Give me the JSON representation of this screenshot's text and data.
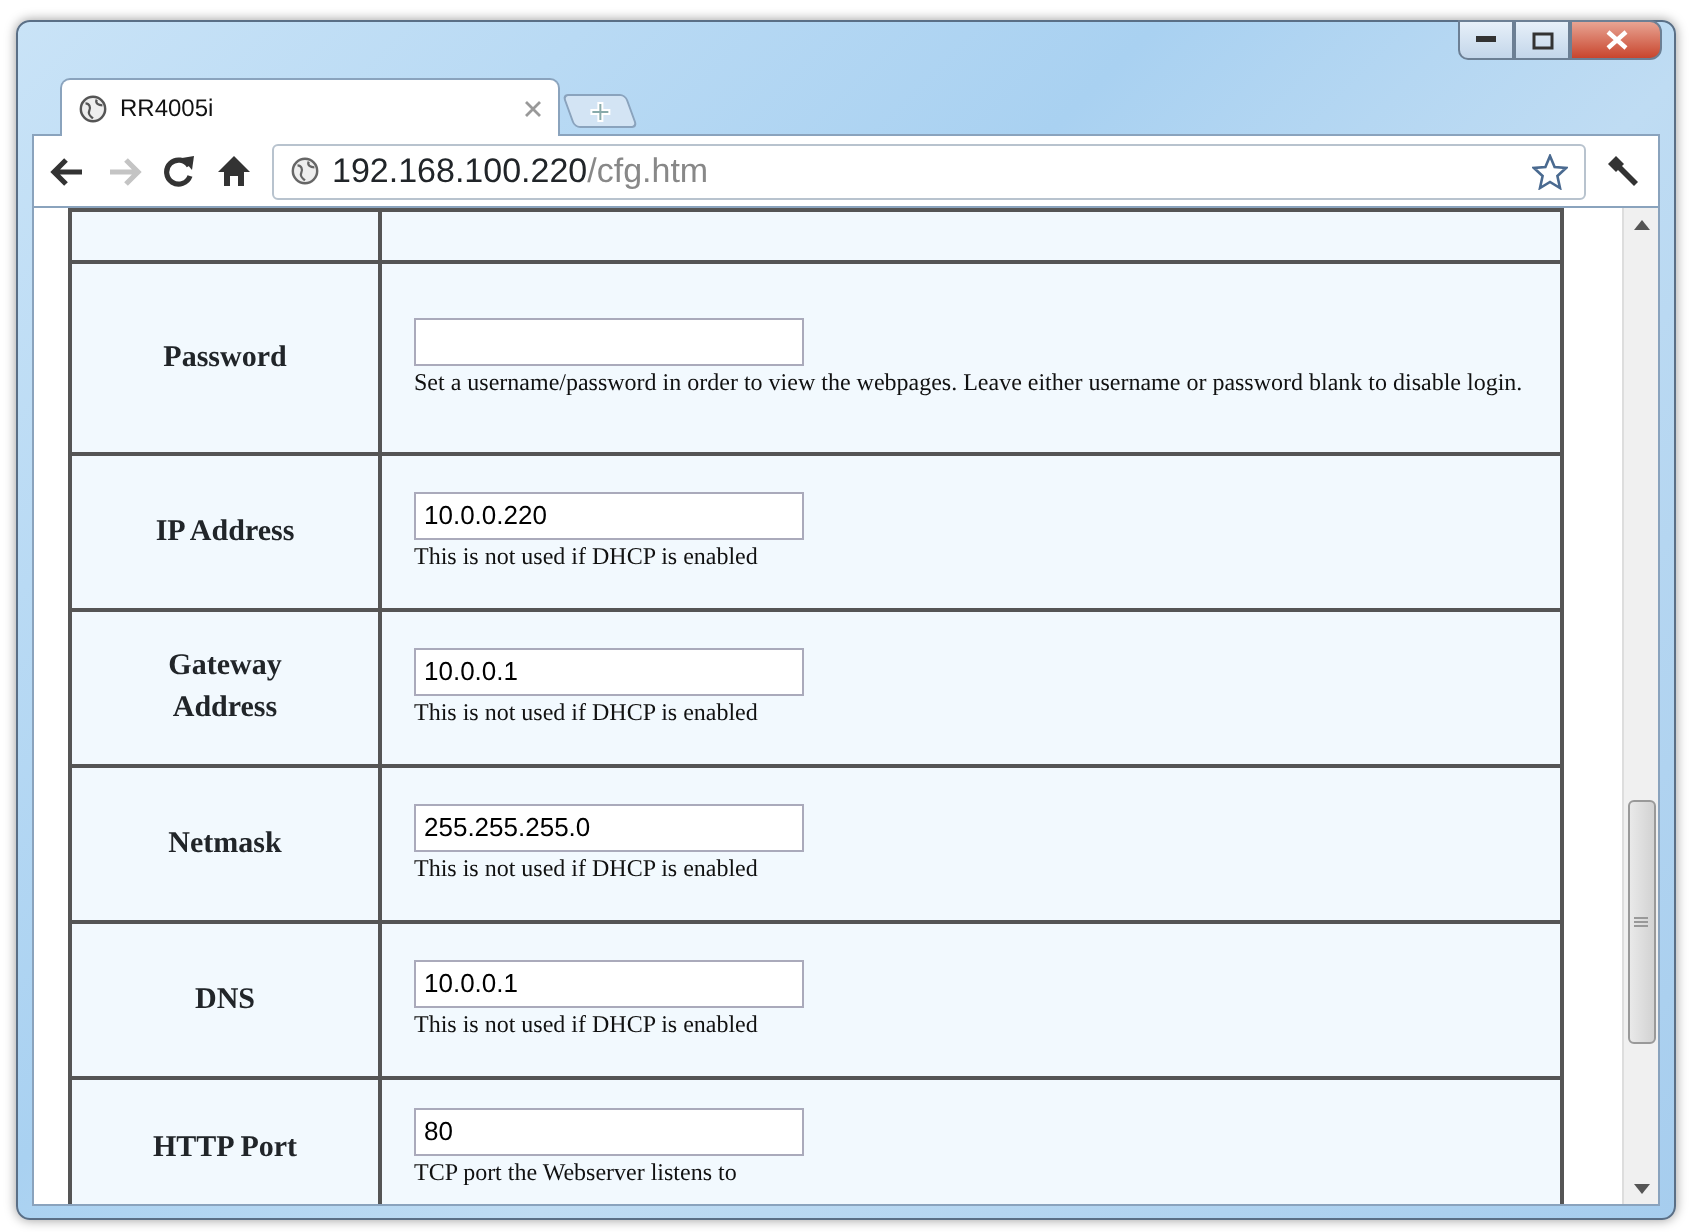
{
  "tab": {
    "title": "RR4005i",
    "selected": true
  },
  "toolbar": {
    "forward_disabled": true
  },
  "address": {
    "host": "192.168.100.220",
    "path": "/cfg.htm"
  },
  "rows": [
    {
      "label": "Password",
      "hint": "Set a username/password in order to view the webpages. Leave either username or password blank to disable login."
    },
    {
      "label": "IP Address",
      "value": "10.0.0.220",
      "hint": "This is not used if DHCP is enabled"
    },
    {
      "label": "Gateway Address",
      "value": "10.0.0.1",
      "hint": "This is not used if DHCP is enabled"
    },
    {
      "label": "Netmask",
      "value": "255.255.255.0",
      "hint": "This is not used if DHCP is enabled"
    },
    {
      "label": "DNS",
      "value": "10.0.0.1",
      "hint": "This is not used if DHCP is enabled"
    },
    {
      "label": "HTTP Port",
      "value": "80",
      "hint": "TCP port the Webserver listens to"
    }
  ]
}
